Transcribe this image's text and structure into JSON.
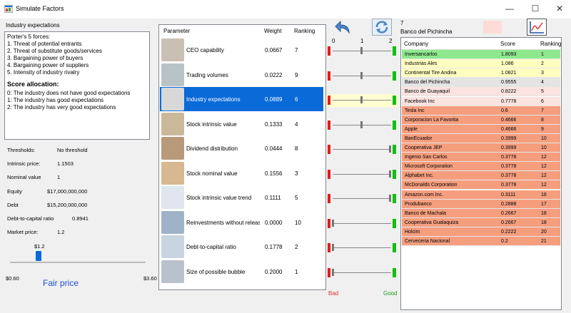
{
  "window": {
    "title": "Simulate Factors"
  },
  "left": {
    "group_label": "Industry expectations",
    "description_lines": [
      "Porter's 5 forces:",
      "1. Threat of potential entrants",
      "2. Threat of substitute goods/services",
      "3. Bargaining power of buyers",
      "4. Bargaining power of suppliers",
      "5. Intensity of industry rivalry"
    ],
    "allocation_head": "Score allocation:",
    "allocation_lines": [
      "0: The industry does not have good expectations",
      "1: The industry has good expectations",
      "2: The industry has very good expectations"
    ],
    "thresholds_label": "Thresholds:",
    "thresholds_value": "No threshold",
    "intrinsic_label": "Intrinsic price:",
    "intrinsic_value": "1.1503",
    "nominal_label": "Nominal value",
    "nominal_value": "1",
    "equity_label": "Equity",
    "equity_value": "$17,000,000,000",
    "debt_label": "Debt",
    "debt_value": "$15,200,000,000",
    "dtc_label": "Debt-to-capital ratio",
    "dtc_value": "0.8941",
    "market_label": "Market price:",
    "market_value": "1.2",
    "slider_value": "$1.2",
    "slider_min": "$0.60",
    "slider_max": "$3.60",
    "fair_price": "Fair price"
  },
  "params": {
    "headers": [
      "Parameter",
      "Weight",
      "Ranking"
    ],
    "rows": [
      {
        "name": "CEO capability",
        "weight": "0.0667",
        "ranking": "7",
        "slider": 1
      },
      {
        "name": "Trading volumes",
        "weight": "0.0222",
        "ranking": "9",
        "slider": 1
      },
      {
        "name": "Industry expectations",
        "weight": "0.0889",
        "ranking": "6",
        "slider": 1
      },
      {
        "name": "Stock intrinsic value",
        "weight": "0.1333",
        "ranking": "4",
        "slider": 1
      },
      {
        "name": "Dividend distribution",
        "weight": "0.0444",
        "ranking": "8",
        "slider": 2
      },
      {
        "name": "Stock nominal value",
        "weight": "0.1556",
        "ranking": "3",
        "slider": 2
      },
      {
        "name": "Stock intrinsic value trend",
        "weight": "0.1111",
        "ranking": "5",
        "slider": 2
      },
      {
        "name": "Reinvestments without releas...",
        "weight": "0.0000",
        "ranking": "10",
        "slider": 0
      },
      {
        "name": "Debt-to-capital ratio",
        "weight": "0.1778",
        "ranking": "2",
        "slider": 0
      },
      {
        "name": "Size of possible bubble",
        "weight": "0.2000",
        "ranking": "1",
        "slider": 0
      }
    ]
  },
  "scale": {
    "ticks": [
      "0",
      "1",
      "2"
    ],
    "bad": "Bad",
    "good": "Good"
  },
  "selected": {
    "rank": "7",
    "company": "Banco del Pichincha"
  },
  "companies": {
    "headers": [
      "Company",
      "Score",
      "Ranking"
    ],
    "rows": [
      {
        "name": "Inversancarlos",
        "score": "1.8093",
        "rank": "1",
        "color": "#8ee98e"
      },
      {
        "name": "Industrias Ales",
        "score": "1.086",
        "rank": "2",
        "color": "#ffffc0"
      },
      {
        "name": "Continental Tire Andina",
        "score": "1.0821",
        "rank": "3",
        "color": "#ffffc0"
      },
      {
        "name": "Banco del Pichincha",
        "score": "0.9555",
        "rank": "4",
        "color": "#e4e4e4"
      },
      {
        "name": "Banco de Guayaquil",
        "score": "0.8222",
        "rank": "5",
        "color": "#fbe3e0"
      },
      {
        "name": "Facebook Inc",
        "score": "0.7778",
        "rank": "6",
        "color": "#fbe3e0"
      },
      {
        "name": "Tesla Inc",
        "score": "0.6",
        "rank": "7",
        "color": "#f59e7e"
      },
      {
        "name": "Corporacion La Favorita",
        "score": "0.4666",
        "rank": "8",
        "color": "#f59e7e"
      },
      {
        "name": "Apple",
        "score": "0.4666",
        "rank": "9",
        "color": "#f59e7e"
      },
      {
        "name": "BanEcuador",
        "score": "0.3999",
        "rank": "10",
        "color": "#f59e7e"
      },
      {
        "name": "Cooperativa JEP",
        "score": "0.3999",
        "rank": "10",
        "color": "#f59e7e"
      },
      {
        "name": "Ingenio San Carlos",
        "score": "0.3778",
        "rank": "12",
        "color": "#f59e7e"
      },
      {
        "name": "Microsoft Corporation",
        "score": "0.3778",
        "rank": "12",
        "color": "#f59e7e"
      },
      {
        "name": "Alphabet Inc.",
        "score": "0.3778",
        "rank": "12",
        "color": "#f59e7e"
      },
      {
        "name": "McDonalds Corporation",
        "score": "0.3778",
        "rank": "12",
        "color": "#f59e7e"
      },
      {
        "name": "Amazon.com Inc.",
        "score": "0.3111",
        "rank": "16",
        "color": "#f59e7e"
      },
      {
        "name": "Produbanco",
        "score": "0.2888",
        "rank": "17",
        "color": "#f59e7e"
      },
      {
        "name": "Banco de Machala",
        "score": "0.2667",
        "rank": "18",
        "color": "#f59e7e"
      },
      {
        "name": "Cooperativa Gualaquiza",
        "score": "0.2667",
        "rank": "18",
        "color": "#f59e7e"
      },
      {
        "name": "Holcim",
        "score": "0.2222",
        "rank": "20",
        "color": "#f59e7e"
      },
      {
        "name": "Cerveceria Nacional",
        "score": "0.2",
        "rank": "21",
        "color": "#f59e7e"
      }
    ]
  }
}
